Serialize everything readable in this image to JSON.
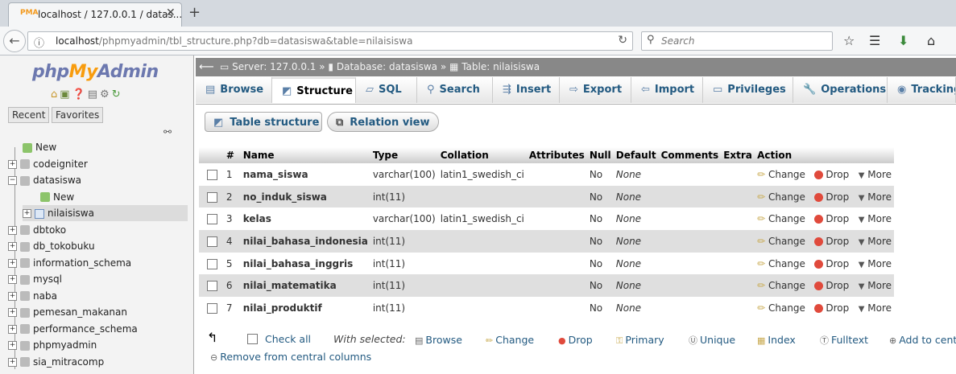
{
  "browser": {
    "tab_title": "localhost / 127.0.0.1 / datas...",
    "favicon_text": "PMA",
    "url_host": "localhost",
    "url_path": "/phpmyadmin/tbl_structure.php?db=datasiswa&table=nilaisiswa",
    "search_placeholder": "Search"
  },
  "sidebar": {
    "logo": {
      "php": "php",
      "my": "My",
      "admin": "Admin"
    },
    "tabs": [
      "Recent",
      "Favorites"
    ],
    "tree": [
      {
        "label": "New",
        "kind": "new"
      },
      {
        "label": "codeigniter",
        "kind": "db"
      },
      {
        "label": "datasiswa",
        "kind": "db-open"
      },
      {
        "label": "New",
        "kind": "new"
      },
      {
        "label": "nilaisiswa",
        "kind": "table-selected"
      },
      {
        "label": "dbtoko",
        "kind": "db"
      },
      {
        "label": "db_tokobuku",
        "kind": "db"
      },
      {
        "label": "information_schema",
        "kind": "db"
      },
      {
        "label": "mysql",
        "kind": "db"
      },
      {
        "label": "naba",
        "kind": "db"
      },
      {
        "label": "pemesan_makanan",
        "kind": "db"
      },
      {
        "label": "performance_schema",
        "kind": "db"
      },
      {
        "label": "phpmyadmin",
        "kind": "db"
      },
      {
        "label": "sia_mitracomp",
        "kind": "db"
      }
    ]
  },
  "breadcrumb": {
    "server": "Server: 127.0.0.1",
    "database": "Database: datasiswa",
    "table": "Table: nilaisiswa",
    "sep": "»"
  },
  "menu_tabs": [
    "Browse",
    "Structure",
    "SQL",
    "Search",
    "Insert",
    "Export",
    "Import",
    "Privileges",
    "Operations",
    "Tracking"
  ],
  "subtabs": {
    "table_structure": "Table structure",
    "relation_view": "Relation view"
  },
  "table": {
    "headers": [
      "#",
      "Name",
      "Type",
      "Collation",
      "Attributes",
      "Null",
      "Default",
      "Comments",
      "Extra",
      "Action"
    ],
    "rows": [
      {
        "num": "1",
        "name": "nama_siswa",
        "type": "varchar(100)",
        "collation": "latin1_swedish_ci",
        "null": "No",
        "default": "None"
      },
      {
        "num": "2",
        "name": "no_induk_siswa",
        "type": "int(11)",
        "collation": "",
        "null": "No",
        "default": "None"
      },
      {
        "num": "3",
        "name": "kelas",
        "type": "varchar(100)",
        "collation": "latin1_swedish_ci",
        "null": "No",
        "default": "None"
      },
      {
        "num": "4",
        "name": "nilai_bahasa_indonesia",
        "type": "int(11)",
        "collation": "",
        "null": "No",
        "default": "None"
      },
      {
        "num": "5",
        "name": "nilai_bahasa_inggris",
        "type": "int(11)",
        "collation": "",
        "null": "No",
        "default": "None"
      },
      {
        "num": "6",
        "name": "nilai_matematika",
        "type": "int(11)",
        "collation": "",
        "null": "No",
        "default": "None"
      },
      {
        "num": "7",
        "name": "nilai_produktif",
        "type": "int(11)",
        "collation": "",
        "null": "No",
        "default": "None"
      }
    ],
    "actions": {
      "change": "Change",
      "drop": "Drop",
      "more": "More"
    }
  },
  "bottom": {
    "check_all": "Check all",
    "with_selected": "With selected:",
    "browse": "Browse",
    "change": "Change",
    "drop": "Drop",
    "primary": "Primary",
    "unique": "Unique",
    "index": "Index",
    "fulltext": "Fulltext",
    "add_to_central": "Add to centr",
    "remove_central": "Remove from central columns"
  },
  "colors": {
    "link": "#235a81",
    "breadcrumb_bg": "#888888",
    "logo_orange": "#f89c0e",
    "logo_blue": "#6c78af"
  }
}
